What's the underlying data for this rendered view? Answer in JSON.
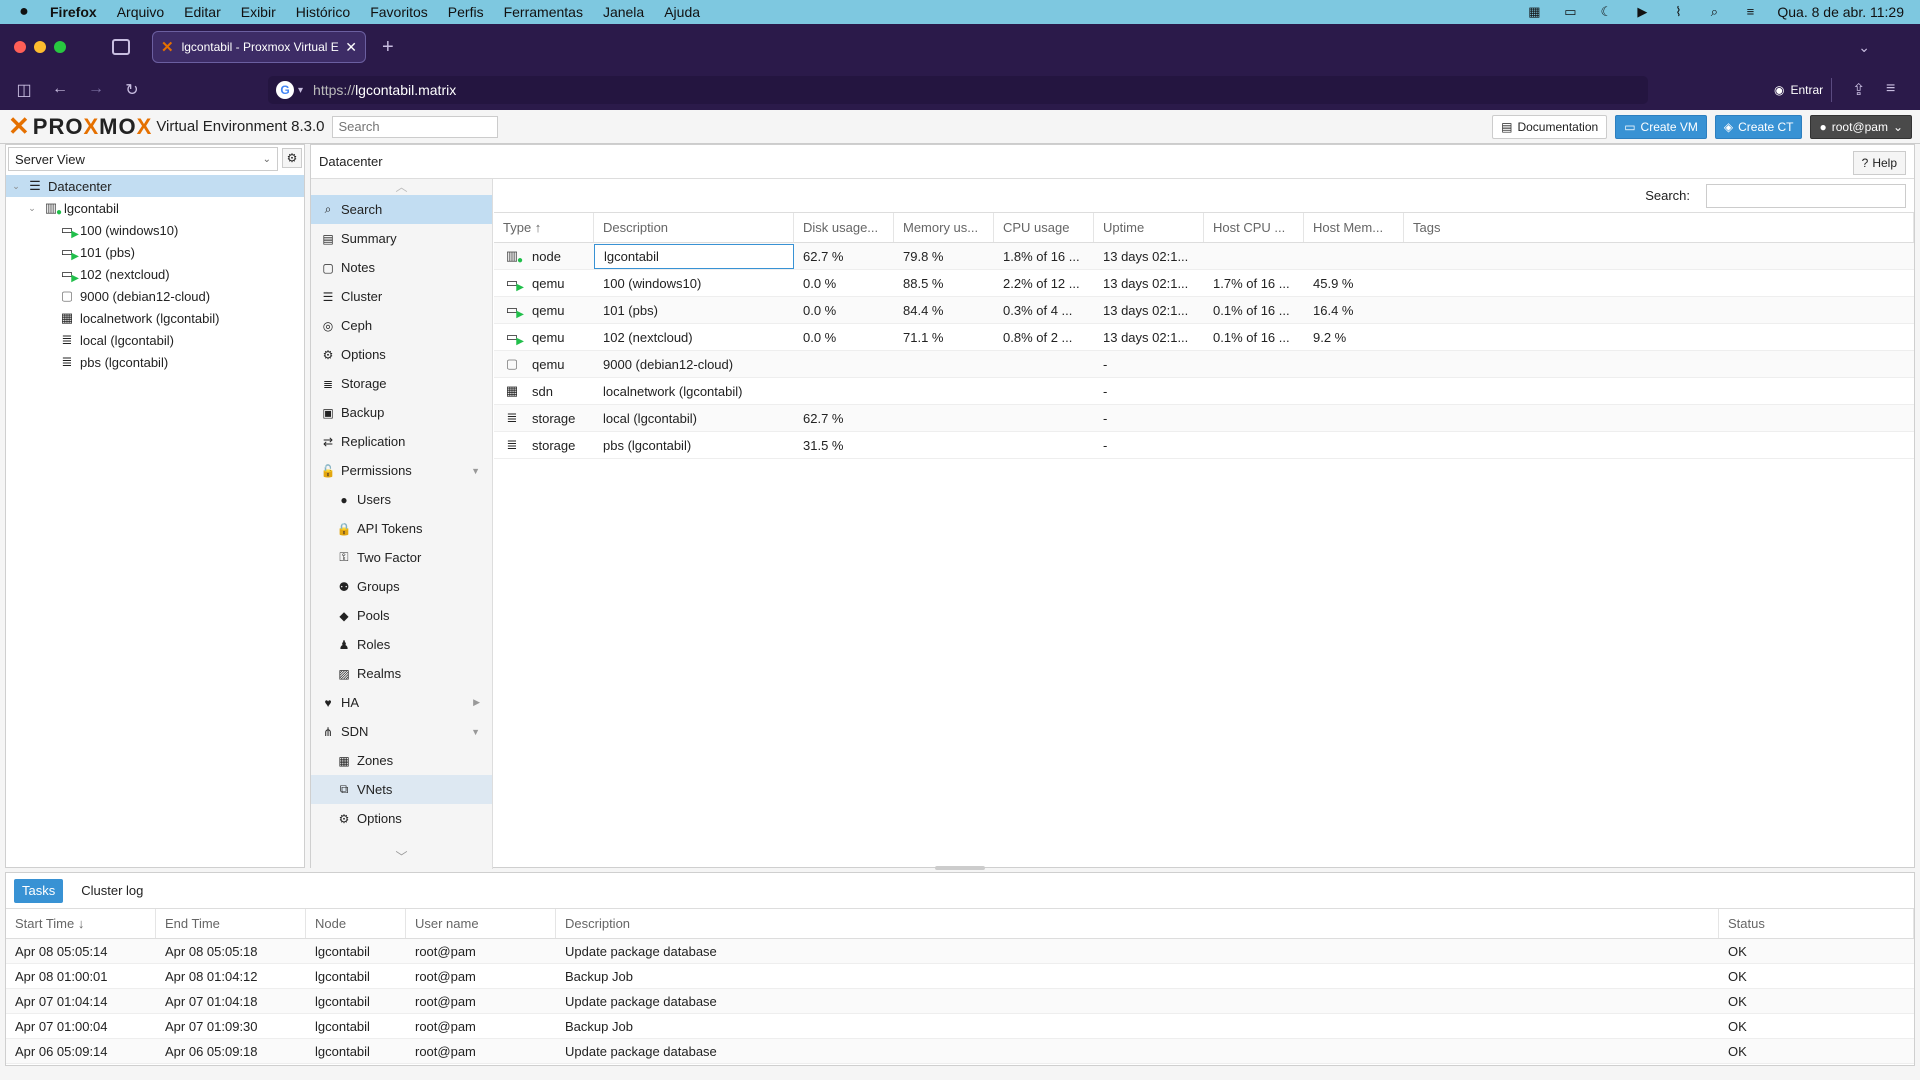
{
  "menubar": {
    "app": "Firefox",
    "items": [
      "Arquivo",
      "Editar",
      "Exibir",
      "Histórico",
      "Favoritos",
      "Perfis",
      "Ferramentas",
      "Janela",
      "Ajuda"
    ],
    "clock": "Qua. 8 de abr.  11:29"
  },
  "browser": {
    "tab_title": "lgcontabil - Proxmox Virtual Environment",
    "url_prefix": "https://",
    "url_host": "lgcontabil.matrix",
    "signin": "Entrar"
  },
  "pve": {
    "version": "Virtual Environment 8.3.0",
    "search_placeholder": "Search",
    "documentation": "Documentation",
    "create_vm": "Create VM",
    "create_ct": "Create CT",
    "user": "root@pam"
  },
  "tree": {
    "view": "Server View",
    "datacenter": "Datacenter",
    "node": "lgcontabil",
    "children": [
      {
        "label": "100 (windows10)",
        "kind": "vm-running"
      },
      {
        "label": "101 (pbs)",
        "kind": "vm-running"
      },
      {
        "label": "102 (nextcloud)",
        "kind": "vm-running"
      },
      {
        "label": "9000 (debian12-cloud)",
        "kind": "template"
      },
      {
        "label": "localnetwork (lgcontabil)",
        "kind": "sdn"
      },
      {
        "label": "local (lgcontabil)",
        "kind": "storage"
      },
      {
        "label": "pbs (lgcontabil)",
        "kind": "storage"
      }
    ]
  },
  "content": {
    "title": "Datacenter",
    "help": "Help",
    "search_label": "Search:"
  },
  "menu": [
    {
      "label": "Search",
      "icon": "search-icon",
      "sub": false,
      "state": "active"
    },
    {
      "label": "Summary",
      "icon": "book-icon",
      "sub": false
    },
    {
      "label": "Notes",
      "icon": "note-icon",
      "sub": false
    },
    {
      "label": "Cluster",
      "icon": "server-icon",
      "sub": false
    },
    {
      "label": "Ceph",
      "icon": "ceph-icon",
      "sub": false
    },
    {
      "label": "Options",
      "icon": "gear-icon",
      "sub": false
    },
    {
      "label": "Storage",
      "icon": "database-icon",
      "sub": false
    },
    {
      "label": "Backup",
      "icon": "floppy-icon",
      "sub": false
    },
    {
      "label": "Replication",
      "icon": "retweet-icon",
      "sub": false
    },
    {
      "label": "Permissions",
      "icon": "unlock-icon",
      "sub": false,
      "expand": "down"
    },
    {
      "label": "Users",
      "icon": "user-icon",
      "sub": true
    },
    {
      "label": "API Tokens",
      "icon": "lock-icon",
      "sub": true
    },
    {
      "label": "Two Factor",
      "icon": "key-icon",
      "sub": true
    },
    {
      "label": "Groups",
      "icon": "users-icon",
      "sub": true
    },
    {
      "label": "Pools",
      "icon": "tags-icon",
      "sub": true
    },
    {
      "label": "Roles",
      "icon": "male-icon",
      "sub": true
    },
    {
      "label": "Realms",
      "icon": "id-badge-icon",
      "sub": true
    },
    {
      "label": "HA",
      "icon": "heartbeat-icon",
      "sub": false,
      "expand": "right"
    },
    {
      "label": "SDN",
      "icon": "sdn-icon",
      "sub": false,
      "expand": "down"
    },
    {
      "label": "Zones",
      "icon": "th-icon",
      "sub": true
    },
    {
      "label": "VNets",
      "icon": "network-icon",
      "sub": true,
      "state": "hover"
    },
    {
      "label": "Options",
      "icon": "gear-icon",
      "sub": true
    }
  ],
  "grid": {
    "columns": [
      "Type ↑",
      "Description",
      "Disk usage...",
      "Memory us...",
      "CPU usage",
      "Uptime",
      "Host CPU ...",
      "Host Mem...",
      "Tags"
    ],
    "rows": [
      {
        "type": "node",
        "icon": "node",
        "desc": "lgcontabil",
        "disk": "62.7 %",
        "mem": "79.8 %",
        "cpu": "1.8% of 16 ...",
        "uptime": "13 days 02:1...",
        "hcpu": "",
        "hmem": "",
        "tags": ""
      },
      {
        "type": "qemu",
        "icon": "vm-running",
        "desc": "100 (windows10)",
        "disk": "0.0 %",
        "mem": "88.5 %",
        "cpu": "2.2% of 12 ...",
        "uptime": "13 days 02:1...",
        "hcpu": "1.7% of 16 ...",
        "hmem": "45.9 %",
        "tags": ""
      },
      {
        "type": "qemu",
        "icon": "vm-running",
        "desc": "101 (pbs)",
        "disk": "0.0 %",
        "mem": "84.4 %",
        "cpu": "0.3% of 4 ...",
        "uptime": "13 days 02:1...",
        "hcpu": "0.1% of 16 ...",
        "hmem": "16.4 %",
        "tags": ""
      },
      {
        "type": "qemu",
        "icon": "vm-running",
        "desc": "102 (nextcloud)",
        "disk": "0.0 %",
        "mem": "71.1 %",
        "cpu": "0.8% of 2 ...",
        "uptime": "13 days 02:1...",
        "hcpu": "0.1% of 16 ...",
        "hmem": "9.2 %",
        "tags": ""
      },
      {
        "type": "qemu",
        "icon": "template",
        "desc": "9000 (debian12-cloud)",
        "disk": "",
        "mem": "",
        "cpu": "",
        "uptime": "-",
        "hcpu": "",
        "hmem": "",
        "tags": ""
      },
      {
        "type": "sdn",
        "icon": "sdn",
        "desc": "localnetwork (lgcontabil)",
        "disk": "",
        "mem": "",
        "cpu": "",
        "uptime": "-",
        "hcpu": "",
        "hmem": "",
        "tags": ""
      },
      {
        "type": "storage",
        "icon": "storage",
        "desc": "local (lgcontabil)",
        "disk": "62.7 %",
        "mem": "",
        "cpu": "",
        "uptime": "-",
        "hcpu": "",
        "hmem": "",
        "tags": ""
      },
      {
        "type": "storage",
        "icon": "storage",
        "desc": "pbs (lgcontabil)",
        "disk": "31.5 %",
        "mem": "",
        "cpu": "",
        "uptime": "-",
        "hcpu": "",
        "hmem": "",
        "tags": ""
      }
    ]
  },
  "tasks": {
    "tabs": [
      "Tasks",
      "Cluster log"
    ],
    "columns": [
      "Start Time ↓",
      "End Time",
      "Node",
      "User name",
      "Description",
      "Status"
    ],
    "rows": [
      {
        "start": "Apr 08 05:05:14",
        "end": "Apr 08 05:05:18",
        "node": "lgcontabil",
        "user": "root@pam",
        "desc": "Update package database",
        "status": "OK"
      },
      {
        "start": "Apr 08 01:00:01",
        "end": "Apr 08 01:04:12",
        "node": "lgcontabil",
        "user": "root@pam",
        "desc": "Backup Job",
        "status": "OK"
      },
      {
        "start": "Apr 07 01:04:14",
        "end": "Apr 07 01:04:18",
        "node": "lgcontabil",
        "user": "root@pam",
        "desc": "Update package database",
        "status": "OK"
      },
      {
        "start": "Apr 07 01:00:04",
        "end": "Apr 07 01:09:30",
        "node": "lgcontabil",
        "user": "root@pam",
        "desc": "Backup Job",
        "status": "OK"
      },
      {
        "start": "Apr 06 05:09:14",
        "end": "Apr 06 05:09:18",
        "node": "lgcontabil",
        "user": "root@pam",
        "desc": "Update package database",
        "status": "OK"
      }
    ]
  }
}
